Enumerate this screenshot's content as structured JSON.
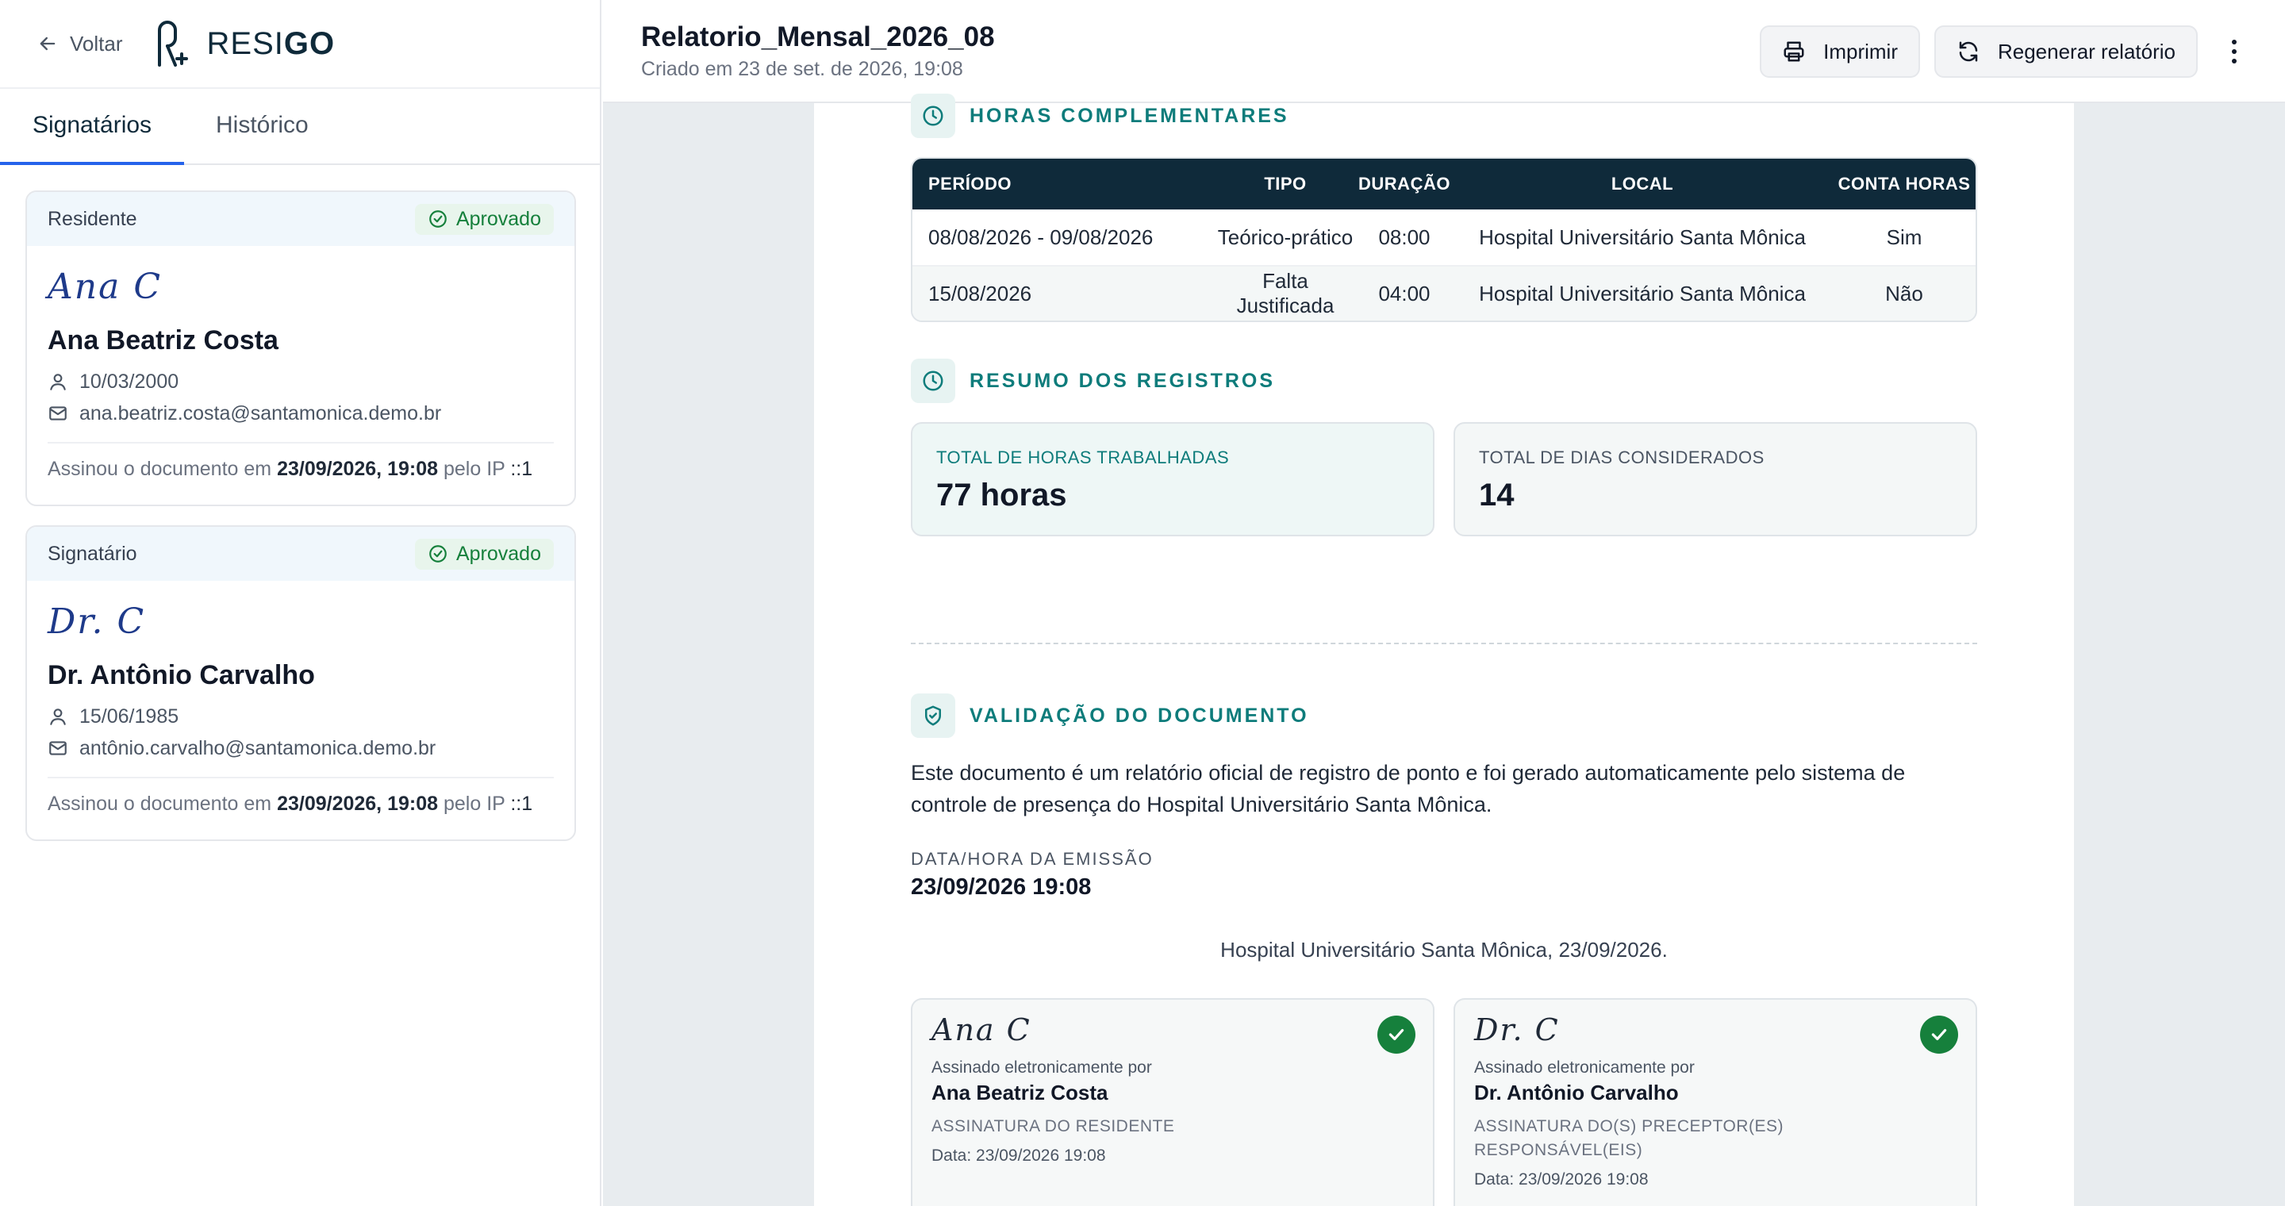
{
  "sidebar": {
    "back_label": "Voltar",
    "logo": {
      "part1": "RESI",
      "part2": "GO"
    },
    "tabs": [
      {
        "label": "Signatários"
      },
      {
        "label": "Histórico"
      }
    ],
    "signers": [
      {
        "role": "Residente",
        "status": "Aprovado",
        "signature_text": "Ana C",
        "name": "Ana Beatriz Costa",
        "birthdate": "10/03/2000",
        "email": "ana.beatriz.costa@santamonica.demo.br",
        "signed_prefix": "Assinou o documento em",
        "signed_at": "23/09/2026, 19:08",
        "ip_prefix": "pelo IP",
        "ip": "::1"
      },
      {
        "role": "Signatário",
        "status": "Aprovado",
        "signature_text": "Dr. C",
        "name": "Dr. Antônio Carvalho",
        "birthdate": "15/06/1985",
        "email": "antônio.carvalho@santamonica.demo.br",
        "signed_prefix": "Assinou o documento em",
        "signed_at": "23/09/2026, 19:08",
        "ip_prefix": "pelo IP",
        "ip": "::1"
      }
    ]
  },
  "header": {
    "title": "Relatorio_Mensal_2026_08",
    "subtitle": "Criado em 23 de set. de 2026, 19:08",
    "print_label": "Imprimir",
    "regenerate_label": "Regenerar relatório"
  },
  "document": {
    "hours_section_title": "HORAS COMPLEMENTARES",
    "table": {
      "headers": [
        "PERÍODO",
        "TIPO",
        "DURAÇÃO",
        "LOCAL",
        "CONTA HORAS"
      ],
      "rows": [
        [
          "08/08/2026 - 09/08/2026",
          "Teórico-prático",
          "08:00",
          "Hospital Universitário Santa Mônica",
          "Sim"
        ],
        [
          "15/08/2026",
          "Falta Justificada",
          "04:00",
          "Hospital Universitário Santa Mônica",
          "Não"
        ]
      ]
    },
    "summary_section_title": "RESUMO DOS REGISTROS",
    "summary": {
      "hours_label": "TOTAL DE HORAS TRABALHADAS",
      "hours_value": "77 horas",
      "days_label": "TOTAL DE DIAS CONSIDERADOS",
      "days_value": "14"
    },
    "validation_section_title": "VALIDAÇÃO DO DOCUMENTO",
    "validation_text": "Este documento é um relatório oficial de registro de ponto e foi gerado automaticamente pelo sistema de controle de presença do Hospital Universitário Santa Mônica.",
    "emission_label": "DATA/HORA DA EMISSÃO",
    "emission_value": "23/09/2026 19:08",
    "place_date": "Hospital Universitário Santa Mônica, 23/09/2026.",
    "signatures": [
      {
        "script": "Ana C",
        "signed_by_label": "Assinado eletronicamente por",
        "name": "Ana Beatriz Costa",
        "role": "ASSINATURA DO RESIDENTE",
        "date": "Data: 23/09/2026 19:08"
      },
      {
        "script": "Dr. C",
        "signed_by_label": "Assinado eletronicamente por",
        "name": "Dr. Antônio Carvalho",
        "role": "ASSINATURA DO(S) PRECEPTOR(ES) RESPONSÁVEL(EIS)",
        "date": "Data: 23/09/2026 19:08"
      }
    ]
  },
  "colors": {
    "accent_teal": "#0e7c7b",
    "table_header": "#0f2a3a",
    "approved_green": "#16803c",
    "active_tab": "#2563eb"
  },
  "icons": [
    "arrow-left-icon",
    "logo-icon",
    "check-circle-icon",
    "user-icon",
    "mail-icon",
    "printer-icon",
    "refresh-icon",
    "more-vertical-icon",
    "clock-icon",
    "shield-check-icon",
    "check-icon"
  ]
}
